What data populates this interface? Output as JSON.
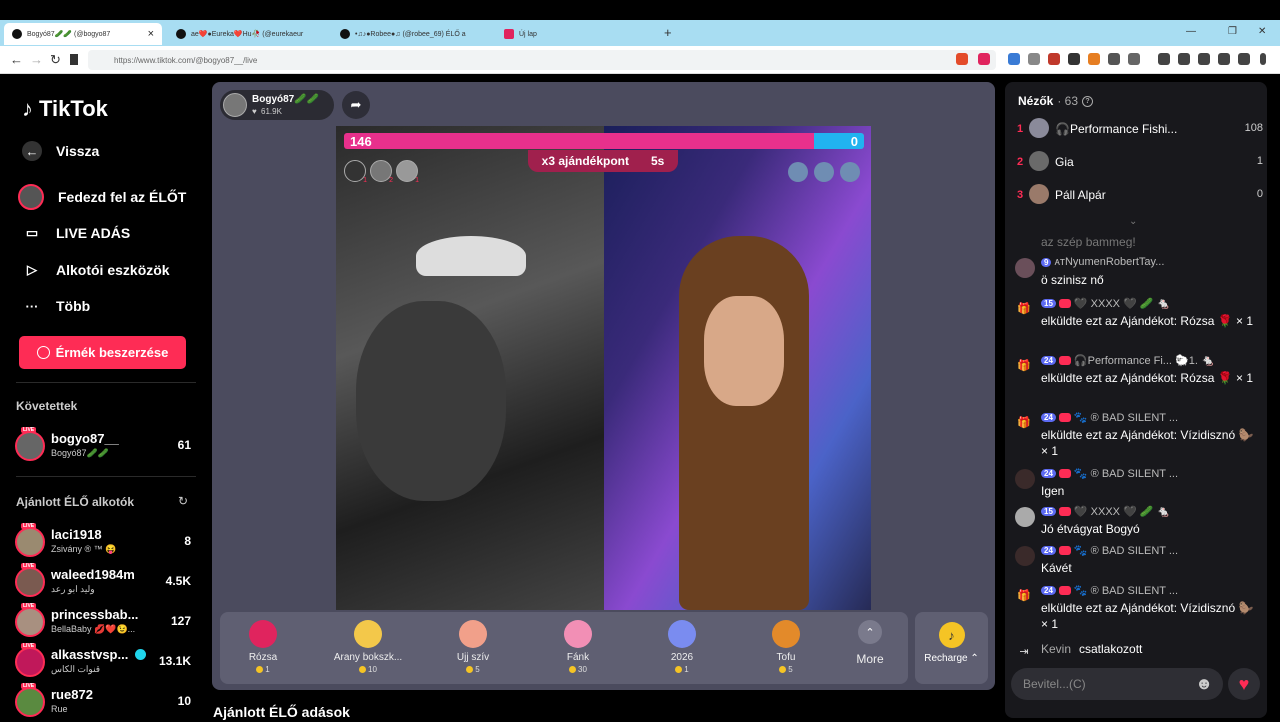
{
  "browser": {
    "tabs": [
      {
        "label": "Bogyó87🥒🥒 (@bogyo87",
        "close": "×"
      },
      {
        "label": "ae❤️●Eureka❤️Hu🥀 (@eurekaeur",
        "close": ""
      },
      {
        "label": "•♫♪●Robee●♫ (@robee_69) ÉLŐ a",
        "close": ""
      },
      {
        "label": "Új lap",
        "close": ""
      }
    ],
    "new_tab": "+",
    "window_controls": [
      "—",
      "❐",
      "✕"
    ],
    "url": "https://www.tiktok.com/@bogyo87__/live",
    "nav_back": "←",
    "nav_forward": "→",
    "nav_reload": "↻"
  },
  "sidebar": {
    "logo": "TikTok",
    "nav": [
      {
        "label": "Vissza",
        "icon": "←"
      },
      {
        "label": "Fedezd fel az ÉLŐT",
        "icon": "◉"
      },
      {
        "label": "LIVE ADÁS",
        "icon": "▭"
      },
      {
        "label": "Alkotói eszközök",
        "icon": "▷"
      },
      {
        "label": "Több",
        "icon": "···"
      }
    ],
    "coin_button": "Érmék beszerzése",
    "following_title": "Követettek",
    "following": [
      {
        "name": "bogyo87__",
        "sub": "Bogyó87🥒🥒",
        "count": "61"
      }
    ],
    "recommended_title": "Ajánlott ÉLŐ alkotók",
    "refresh_icon": "↻",
    "recommended": [
      {
        "name": "laci1918",
        "sub": "Zsivány ® ™ 😝",
        "count": "8"
      },
      {
        "name": "waleed1984m",
        "sub": "وليد ابو رعد",
        "count": "4.5K"
      },
      {
        "name": "princessbab...",
        "sub": "BellaBaby 💋❤️😉...",
        "count": "127"
      },
      {
        "name": "alkasstvsp...",
        "sub": "قنوات الكاس",
        "count": "13.1K"
      },
      {
        "name": "rue872",
        "sub": "Rue",
        "count": "10"
      }
    ],
    "live_tag": "LIVE"
  },
  "host": {
    "name": "Bogyó87🥒🥒",
    "likes": "61.9K",
    "heart": "♥"
  },
  "battle": {
    "left_score": "146",
    "right_score": "0",
    "multiplier": "x3 ajándékpont",
    "timer": "5s",
    "rank_badges": [
      "1",
      "2",
      "1"
    ]
  },
  "gifts": [
    {
      "name": "Rózsa",
      "price": "1",
      "color": "#e0245e"
    },
    {
      "name": "Arany bokszk...",
      "price": "10",
      "color": "#f3c84a"
    },
    {
      "name": "Ujj szív",
      "price": "5",
      "color": "#f1a08a"
    },
    {
      "name": "Fánk",
      "price": "30",
      "color": "#f28fb5"
    },
    {
      "name": "2026",
      "price": "1",
      "color": "#7a8cf0"
    },
    {
      "name": "Tofu",
      "price": "5",
      "color": "#e38a2a"
    }
  ],
  "more_label": "More",
  "more_icon": "⌃",
  "recharge_label": "Recharge ⌃",
  "recharge_icon": "♪",
  "viewers": {
    "title": "Nézők",
    "count": "· 63",
    "help_icon": "?",
    "list": [
      {
        "rank": "1",
        "name": "🎧Performance Fishi...",
        "score": "108"
      },
      {
        "rank": "2",
        "name": "Gia",
        "score": "1"
      },
      {
        "rank": "3",
        "name": "Páll Alpár",
        "score": "0"
      }
    ],
    "collapse_icon": "⌄"
  },
  "chat": [
    {
      "kind": "faded",
      "text": "az szép bammeg!"
    },
    {
      "kind": "avatar",
      "badge": "9",
      "user": "ᴀᴛNyumenRobertTay...",
      "text": "ö szinisz nő"
    },
    {
      "kind": "gift",
      "badge": "15",
      "user": "🖤 XXXX 🖤 🥒 🐁",
      "text": "elküldte ezt az Ajándékot: Rózsa 🌹 × 1"
    },
    {
      "kind": "gift",
      "badge": "24",
      "user": "🎧Performance Fi... 🐑1. 🐁",
      "text": "elküldte ezt az Ajándékot: Rózsa 🌹 × 1"
    },
    {
      "kind": "gift",
      "badge": "24",
      "user": "🐾 ® BAD SILENT ...",
      "text": "elküldte ezt az Ajándékot: Vízidisznó 🦫 × 1"
    },
    {
      "kind": "avatar",
      "badge": "24",
      "user": "🐾 ® BAD SILENT ...",
      "text": "Igen"
    },
    {
      "kind": "avatar",
      "badge": "15",
      "user": "🖤 XXXX 🖤 🥒 🐁",
      "text": "Jó étvágyat Bogyó"
    },
    {
      "kind": "avatar",
      "badge": "24",
      "user": "🐾 ® BAD SILENT ...",
      "text": "Kávét"
    },
    {
      "kind": "gift",
      "badge": "24",
      "user": "🐾 ® BAD SILENT ...",
      "text": "elküldte ezt az Ajándékot: Vízidisznó 🦫 × 1"
    }
  ],
  "join": {
    "user": "Kevin",
    "text": "csatlakozott",
    "icon": "⇥"
  },
  "input_placeholder": "Bevitel...(C)",
  "emoji_icon": "☻",
  "heart_icon": "♥",
  "recommended_live_heading": "Ajánlott ÉLŐ adások"
}
